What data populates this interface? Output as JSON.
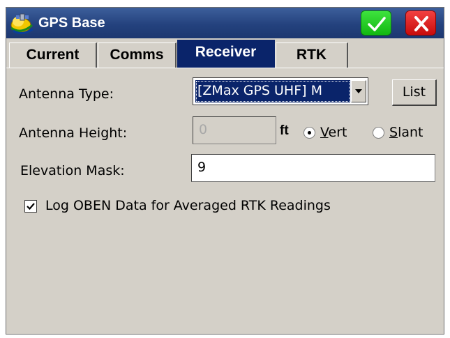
{
  "window": {
    "title": "GPS Base"
  },
  "icons": {
    "app": "gps-satellite-icon",
    "ok": "checkmark-icon",
    "close": "close-icon",
    "dropdown": "chevron-down-icon",
    "checked": "checkmark-icon"
  },
  "colors": {
    "titlebar": "#24427e",
    "ok_button": "#12b812",
    "close_button": "#c80c0c",
    "selection": "#0a246a",
    "panel": "#d4d0c8"
  },
  "tabs": [
    {
      "label": "Current",
      "active": false
    },
    {
      "label": "Comms",
      "active": false
    },
    {
      "label": "Receiver",
      "active": true
    },
    {
      "label": "RTK",
      "active": false
    }
  ],
  "form": {
    "antenna_type_label": "Antenna Type:",
    "antenna_type_value": "[ZMax GPS UHF] M",
    "list_button": "List",
    "antenna_height_label": "Antenna Height:",
    "antenna_height_value": "0",
    "unit": "ft",
    "vert_prefix": "",
    "vert_underline": "V",
    "vert_rest": "ert",
    "slant_underline": "S",
    "slant_rest": "lant",
    "vert_selected": true,
    "elevation_mask_label": "Elevation Mask:",
    "elevation_mask_value": "9",
    "log_oben_label": "Log OBEN Data for Averaged RTK Readings",
    "log_oben_checked": true
  }
}
